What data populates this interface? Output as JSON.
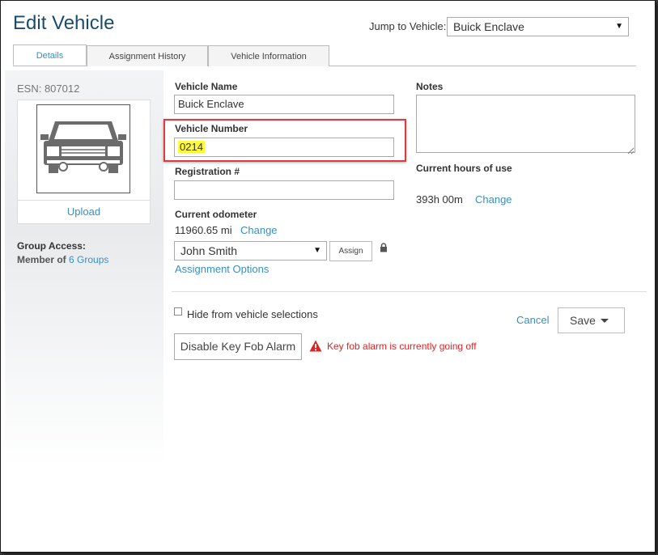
{
  "page": {
    "title": "Edit Vehicle"
  },
  "jump": {
    "label": "Jump to Vehicle:",
    "selected": "Buick Enclave"
  },
  "tabs": [
    {
      "label": "Details",
      "active": true
    },
    {
      "label": "Assignment History",
      "active": false
    },
    {
      "label": "Vehicle Information",
      "active": false
    }
  ],
  "sidebar": {
    "esn": "ESN: 807012",
    "upload_label": "Upload",
    "group_access_title": "Group Access:",
    "group_prefix": "Member of",
    "group_link": "6 Groups"
  },
  "form": {
    "vehicle_name_label": "Vehicle Name",
    "vehicle_name_value": "Buick Enclave",
    "vehicle_number_label": "Vehicle Number",
    "vehicle_number_value": "0214",
    "registration_label": "Registration #",
    "registration_value": "",
    "odometer_label": "Current odometer",
    "odometer_value": "11960.65 mi",
    "odometer_change": "Change",
    "driver_selected": "John Smith",
    "assign_label": "Assign",
    "assignment_options": "Assignment Options",
    "notes_label": "Notes",
    "notes_value": "",
    "hours_label": "Current hours of use",
    "hours_value": "393h 00m",
    "hours_change": "Change",
    "hide_label": "Hide from vehicle selections",
    "hide_checked": false,
    "cancel_label": "Cancel",
    "save_label": "Save",
    "fob_button_label": "Disable Key Fob Alarm",
    "fob_warning": "Key fob alarm is currently going off"
  },
  "colors": {
    "title": "#1a4c6e",
    "link": "#3a8fc0",
    "highlight_border": "#e0393e",
    "highlight_fill": "#fdfb3b",
    "warning": "#e02424"
  }
}
